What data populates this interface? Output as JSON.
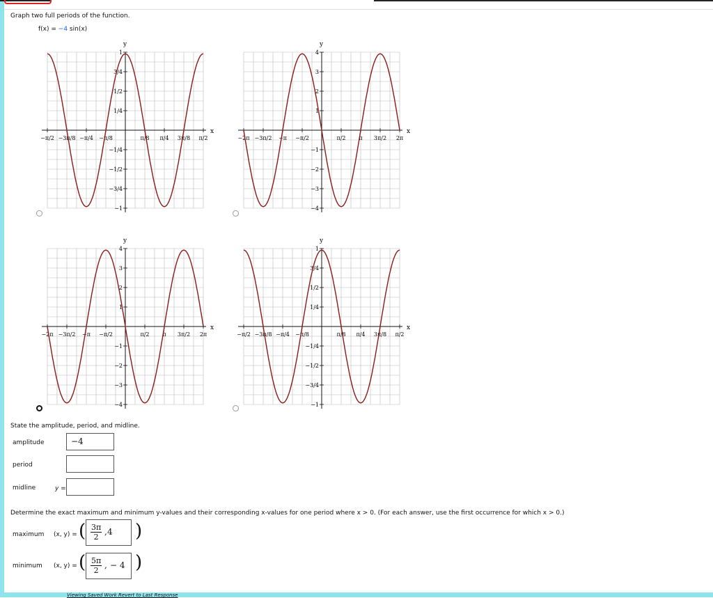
{
  "question": {
    "instruction": "Graph two full periods of the function.",
    "function_lhs": "f(x) = ",
    "function_coef": "−4",
    "function_rhs": " sin(x)"
  },
  "graphs": [
    {
      "id": "A",
      "selected": false,
      "y_ticks": [
        "1",
        "3/4",
        "1/2",
        "1/4",
        "−1/4",
        "−1/2",
        "−3/4",
        "−1"
      ],
      "x_ticks": [
        "−π/2",
        "−3π/8",
        "−π/4",
        "−π/8",
        "π/8",
        "π/4",
        "3π/8",
        "π/2"
      ]
    },
    {
      "id": "B",
      "selected": false,
      "y_ticks": [
        "4",
        "3",
        "2",
        "1",
        "−1",
        "−2",
        "−3",
        "−4"
      ],
      "x_ticks": [
        "−2π",
        "−3π/2",
        "−π",
        "−π/2",
        "π/2",
        "π",
        "3π/2",
        "2π"
      ]
    },
    {
      "id": "C",
      "selected": true,
      "y_ticks": [
        "4",
        "3",
        "2",
        "1",
        "−1",
        "−2",
        "−3",
        "−4"
      ],
      "x_ticks": [
        "−2π",
        "−3π/2",
        "−π",
        "−π/2",
        "π/2",
        "π",
        "3π/2",
        "2π"
      ]
    },
    {
      "id": "D",
      "selected": false,
      "y_ticks": [
        "1",
        "3/4",
        "1/2",
        "1/4",
        "−1/4",
        "−1/2",
        "−3/4",
        "−1"
      ],
      "x_ticks": [
        "−π/2",
        "−3π/8",
        "−π/4",
        "−π/8",
        "π/8",
        "π/4",
        "3π/8",
        "π/2"
      ]
    }
  ],
  "axis_labels": {
    "x": "x",
    "y": "y"
  },
  "colors": {
    "curve": "#8b1a1a",
    "grid": "#bbbbbb",
    "accent": "#8fe3ea",
    "radio_selected": "#111111"
  },
  "part2": {
    "instruction": "State the amplitude, period, and midline.",
    "amplitude_label": "amplitude",
    "amplitude_value": "−4",
    "period_label": "period",
    "period_value": "",
    "midline_label": "midline",
    "midline_prefix": "y =",
    "midline_value": ""
  },
  "part3": {
    "instruction": "Determine the exact maximum and minimum y-values and their corresponding x-values for one period where  x > 0.  (For each answer, use the first occurrence for which  x > 0.)",
    "maximum_label": "maximum",
    "minimum_label": "minimum",
    "xy_label": "(x, y) =",
    "max_x_num": "3π",
    "max_x_den": "2",
    "max_y": "4",
    "min_x_num": "5π",
    "min_x_den": "2",
    "min_y": "− 4"
  },
  "footer": {
    "text": "Viewing Saved Work Revert to Last Response"
  }
}
